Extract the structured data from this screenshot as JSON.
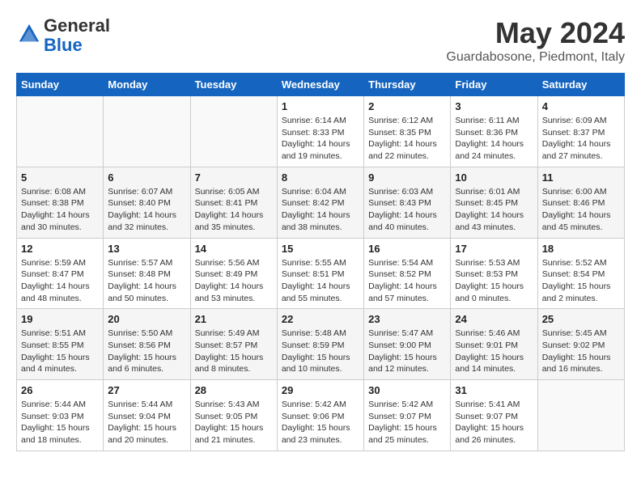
{
  "logo": {
    "line1": "General",
    "line2": "Blue"
  },
  "title": "May 2024",
  "location": "Guardabosone, Piedmont, Italy",
  "days_of_week": [
    "Sunday",
    "Monday",
    "Tuesday",
    "Wednesday",
    "Thursday",
    "Friday",
    "Saturday"
  ],
  "weeks": [
    [
      {
        "num": "",
        "info": ""
      },
      {
        "num": "",
        "info": ""
      },
      {
        "num": "",
        "info": ""
      },
      {
        "num": "1",
        "info": "Sunrise: 6:14 AM\nSunset: 8:33 PM\nDaylight: 14 hours\nand 19 minutes."
      },
      {
        "num": "2",
        "info": "Sunrise: 6:12 AM\nSunset: 8:35 PM\nDaylight: 14 hours\nand 22 minutes."
      },
      {
        "num": "3",
        "info": "Sunrise: 6:11 AM\nSunset: 8:36 PM\nDaylight: 14 hours\nand 24 minutes."
      },
      {
        "num": "4",
        "info": "Sunrise: 6:09 AM\nSunset: 8:37 PM\nDaylight: 14 hours\nand 27 minutes."
      }
    ],
    [
      {
        "num": "5",
        "info": "Sunrise: 6:08 AM\nSunset: 8:38 PM\nDaylight: 14 hours\nand 30 minutes."
      },
      {
        "num": "6",
        "info": "Sunrise: 6:07 AM\nSunset: 8:40 PM\nDaylight: 14 hours\nand 32 minutes."
      },
      {
        "num": "7",
        "info": "Sunrise: 6:05 AM\nSunset: 8:41 PM\nDaylight: 14 hours\nand 35 minutes."
      },
      {
        "num": "8",
        "info": "Sunrise: 6:04 AM\nSunset: 8:42 PM\nDaylight: 14 hours\nand 38 minutes."
      },
      {
        "num": "9",
        "info": "Sunrise: 6:03 AM\nSunset: 8:43 PM\nDaylight: 14 hours\nand 40 minutes."
      },
      {
        "num": "10",
        "info": "Sunrise: 6:01 AM\nSunset: 8:45 PM\nDaylight: 14 hours\nand 43 minutes."
      },
      {
        "num": "11",
        "info": "Sunrise: 6:00 AM\nSunset: 8:46 PM\nDaylight: 14 hours\nand 45 minutes."
      }
    ],
    [
      {
        "num": "12",
        "info": "Sunrise: 5:59 AM\nSunset: 8:47 PM\nDaylight: 14 hours\nand 48 minutes."
      },
      {
        "num": "13",
        "info": "Sunrise: 5:57 AM\nSunset: 8:48 PM\nDaylight: 14 hours\nand 50 minutes."
      },
      {
        "num": "14",
        "info": "Sunrise: 5:56 AM\nSunset: 8:49 PM\nDaylight: 14 hours\nand 53 minutes."
      },
      {
        "num": "15",
        "info": "Sunrise: 5:55 AM\nSunset: 8:51 PM\nDaylight: 14 hours\nand 55 minutes."
      },
      {
        "num": "16",
        "info": "Sunrise: 5:54 AM\nSunset: 8:52 PM\nDaylight: 14 hours\nand 57 minutes."
      },
      {
        "num": "17",
        "info": "Sunrise: 5:53 AM\nSunset: 8:53 PM\nDaylight: 15 hours\nand 0 minutes."
      },
      {
        "num": "18",
        "info": "Sunrise: 5:52 AM\nSunset: 8:54 PM\nDaylight: 15 hours\nand 2 minutes."
      }
    ],
    [
      {
        "num": "19",
        "info": "Sunrise: 5:51 AM\nSunset: 8:55 PM\nDaylight: 15 hours\nand 4 minutes."
      },
      {
        "num": "20",
        "info": "Sunrise: 5:50 AM\nSunset: 8:56 PM\nDaylight: 15 hours\nand 6 minutes."
      },
      {
        "num": "21",
        "info": "Sunrise: 5:49 AM\nSunset: 8:57 PM\nDaylight: 15 hours\nand 8 minutes."
      },
      {
        "num": "22",
        "info": "Sunrise: 5:48 AM\nSunset: 8:59 PM\nDaylight: 15 hours\nand 10 minutes."
      },
      {
        "num": "23",
        "info": "Sunrise: 5:47 AM\nSunset: 9:00 PM\nDaylight: 15 hours\nand 12 minutes."
      },
      {
        "num": "24",
        "info": "Sunrise: 5:46 AM\nSunset: 9:01 PM\nDaylight: 15 hours\nand 14 minutes."
      },
      {
        "num": "25",
        "info": "Sunrise: 5:45 AM\nSunset: 9:02 PM\nDaylight: 15 hours\nand 16 minutes."
      }
    ],
    [
      {
        "num": "26",
        "info": "Sunrise: 5:44 AM\nSunset: 9:03 PM\nDaylight: 15 hours\nand 18 minutes."
      },
      {
        "num": "27",
        "info": "Sunrise: 5:44 AM\nSunset: 9:04 PM\nDaylight: 15 hours\nand 20 minutes."
      },
      {
        "num": "28",
        "info": "Sunrise: 5:43 AM\nSunset: 9:05 PM\nDaylight: 15 hours\nand 21 minutes."
      },
      {
        "num": "29",
        "info": "Sunrise: 5:42 AM\nSunset: 9:06 PM\nDaylight: 15 hours\nand 23 minutes."
      },
      {
        "num": "30",
        "info": "Sunrise: 5:42 AM\nSunset: 9:07 PM\nDaylight: 15 hours\nand 25 minutes."
      },
      {
        "num": "31",
        "info": "Sunrise: 5:41 AM\nSunset: 9:07 PM\nDaylight: 15 hours\nand 26 minutes."
      },
      {
        "num": "",
        "info": ""
      }
    ]
  ]
}
